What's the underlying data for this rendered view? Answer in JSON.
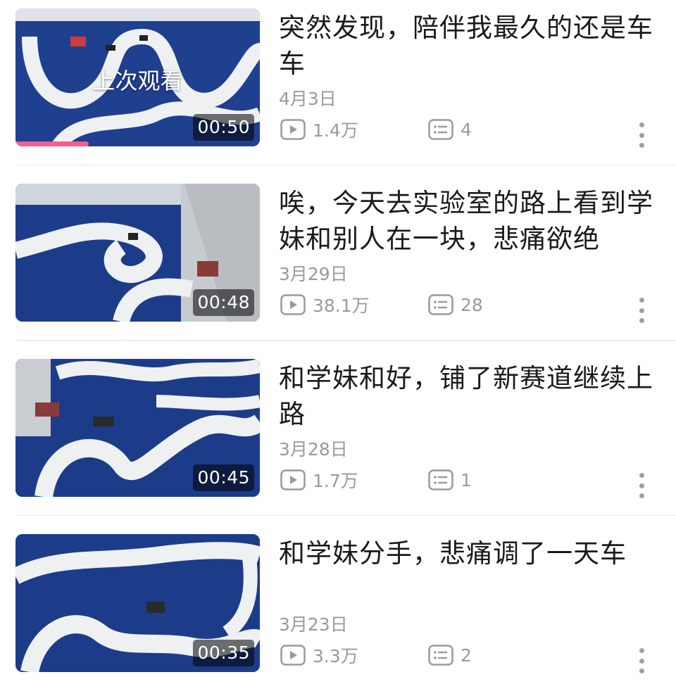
{
  "videos": [
    {
      "title": "突然发现，陪伴我最久的还是车\n车",
      "date": "4月3日",
      "views": "1.4万",
      "comments": "4",
      "duration": "00:50",
      "watched_label": "上次观看",
      "watch_progress_percent": 30
    },
    {
      "title": "唉，今天去实验室的路上看到学\n妹和别人在一块，悲痛欲绝",
      "date": "3月29日",
      "views": "38.1万",
      "comments": "28",
      "duration": "00:48"
    },
    {
      "title": "和学妹和好，铺了新赛道继续上\n路",
      "date": "3月28日",
      "views": "1.7万",
      "comments": "1",
      "duration": "00:45"
    },
    {
      "title": "和学妹分手，悲痛调了一天车",
      "date": "3月23日",
      "views": "3.3万",
      "comments": "2",
      "duration": "00:35"
    }
  ],
  "colors": {
    "progress": "#ff5c8a",
    "track_blue": "#1c3c8a",
    "meta_gray": "#9a9a9a"
  },
  "icons": {
    "views": "play-icon",
    "comments": "comment-icon",
    "more": "more-vertical-icon"
  }
}
